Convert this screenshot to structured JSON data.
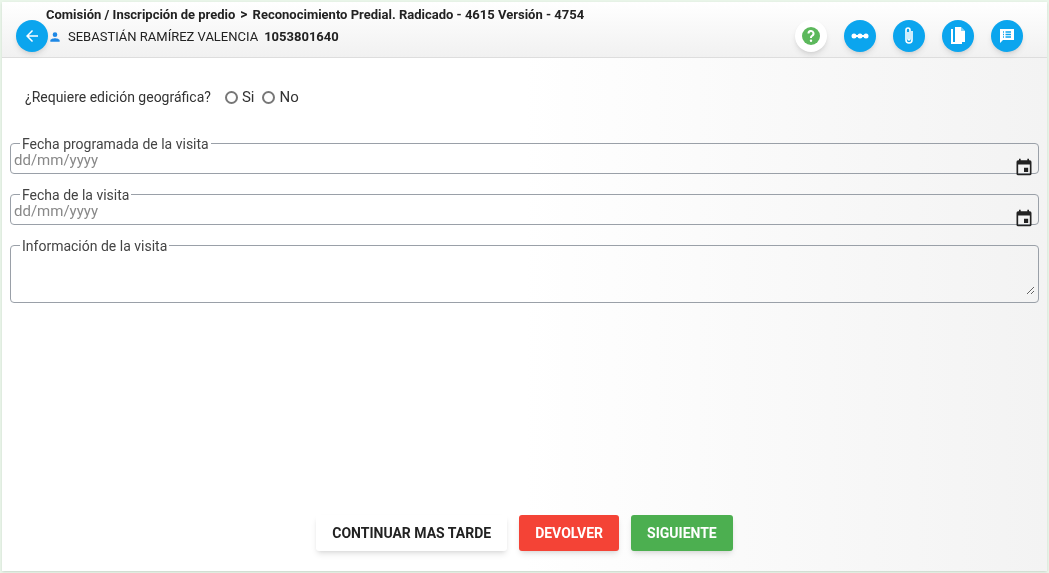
{
  "header": {
    "breadcrumb": "Comisión / Inscripción de predio",
    "separator": ">",
    "title": "Reconocimiento Predial. Radicado - 4615 Versión - 4754",
    "user_name": "SEBASTIÁN RAMÍREZ VALENCIA",
    "user_id": "1053801640"
  },
  "toolbar": [
    {
      "kind": "help"
    },
    {
      "kind": "flow"
    },
    {
      "kind": "attach"
    },
    {
      "kind": "documents"
    },
    {
      "kind": "comments"
    }
  ],
  "question": {
    "label": "¿Requiere edición geográfica?",
    "options": [
      {
        "label": "Si",
        "selected": false
      },
      {
        "label": "No",
        "selected": false
      }
    ]
  },
  "fields": [
    {
      "kind": "date",
      "label": "Fecha programada de la visita",
      "placeholder": "dd/mm/yyyy"
    },
    {
      "kind": "date",
      "label": "Fecha de la visita",
      "placeholder": "dd/mm/yyyy"
    },
    {
      "kind": "textarea",
      "label": "Información de la visita"
    }
  ],
  "buttons": [
    {
      "label": "CONTINUAR MAS TARDE",
      "kind": "plain"
    },
    {
      "label": "DEVOLVER",
      "kind": "danger"
    },
    {
      "label": "SIGUIENTE",
      "kind": "success"
    }
  ]
}
